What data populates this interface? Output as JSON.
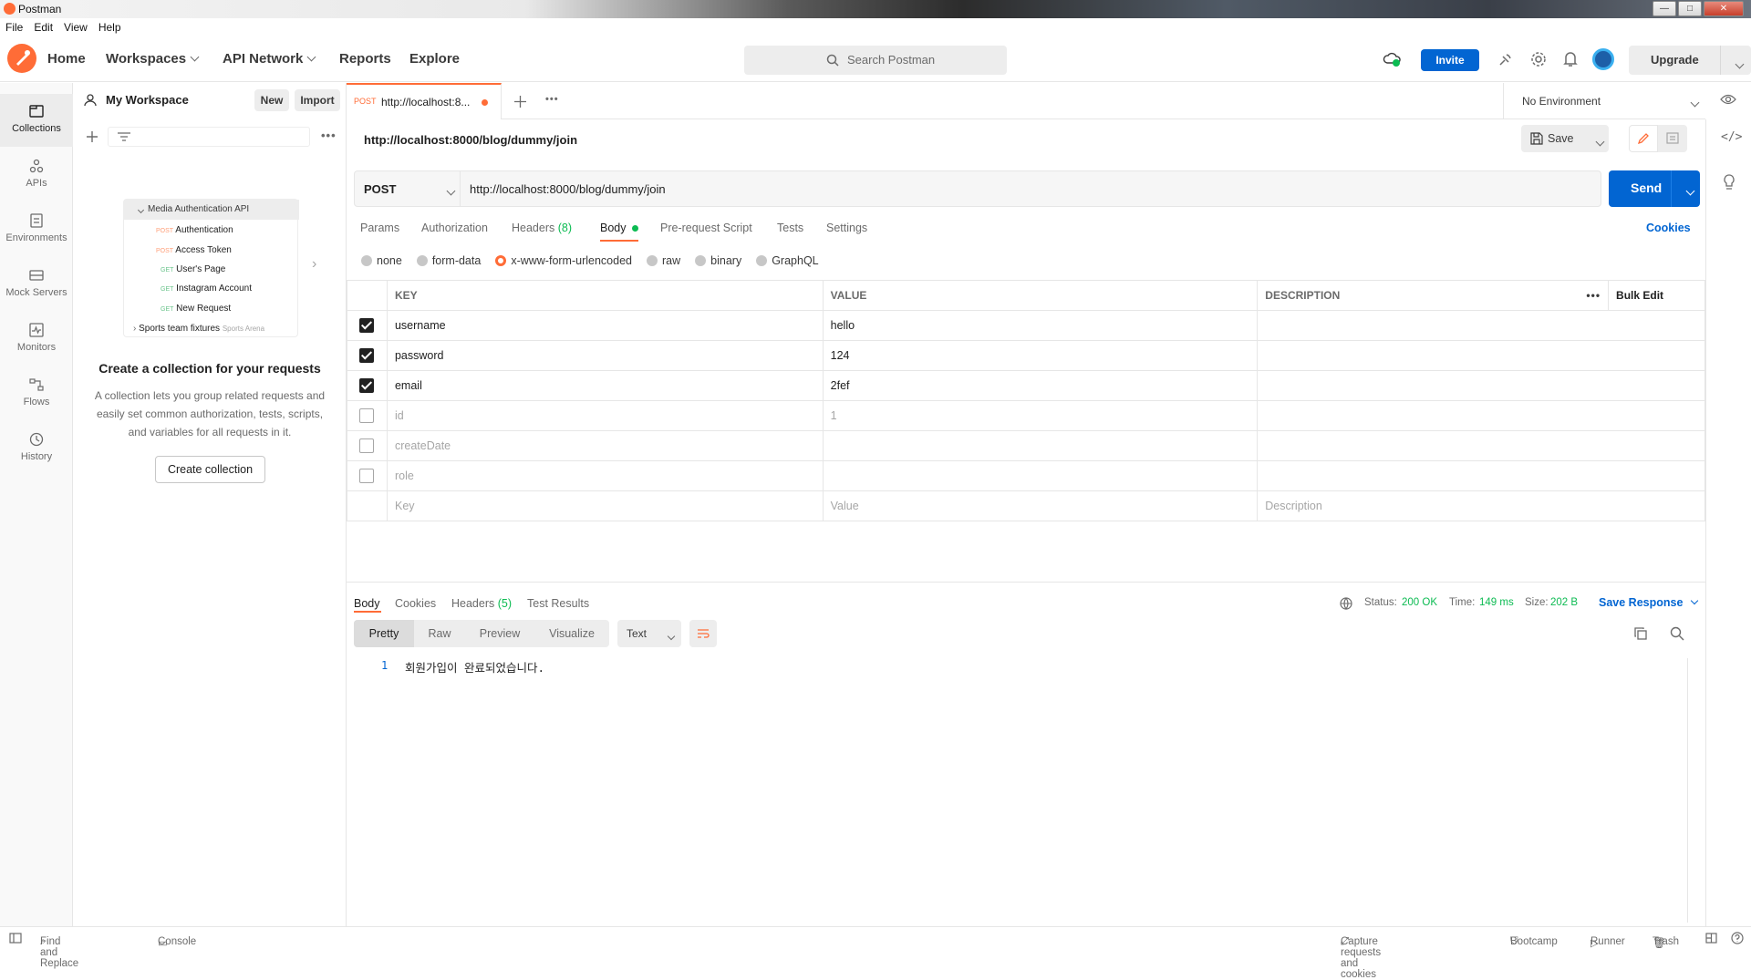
{
  "window": {
    "title": "Postman"
  },
  "menu": [
    "File",
    "Edit",
    "View",
    "Help"
  ],
  "header": {
    "nav": [
      "Home",
      "Workspaces",
      "API Network",
      "Reports",
      "Explore"
    ],
    "search_placeholder": "Search Postman",
    "invite": "Invite",
    "upgrade": "Upgrade"
  },
  "rail": [
    "Collections",
    "APIs",
    "Environments",
    "Mock Servers",
    "Monitors",
    "Flows",
    "History"
  ],
  "sidebar": {
    "workspace": "My Workspace",
    "new": "New",
    "import": "Import",
    "preview": {
      "collection": "Media Authentication API",
      "items": [
        {
          "method": "POST",
          "name": "Authentication"
        },
        {
          "method": "POST",
          "name": "Access Token"
        },
        {
          "method": "GET",
          "name": "User's Page"
        },
        {
          "method": "GET",
          "name": "Instagram Account"
        },
        {
          "method": "GET",
          "name": "New Request"
        }
      ],
      "other": "Sports team fixtures",
      "other_fork": "Sports Arena"
    },
    "empty_title": "Create a collection for your requests",
    "empty_text_1": "A collection lets you group related requests and",
    "empty_text_2": "easily set common authorization, tests, scripts,",
    "empty_text_3": "and variables for all requests in it.",
    "create_button": "Create collection"
  },
  "tab": {
    "method": "POST",
    "title": "http://localhost:8..."
  },
  "environment": "No Environment",
  "request": {
    "name": "http://localhost:8000/blog/dummy/join",
    "save": "Save",
    "method": "POST",
    "url": "http://localhost:8000/blog/dummy/join",
    "send": "Send",
    "tabs": [
      "Params",
      "Authorization",
      "Headers",
      "Body",
      "Pre-request Script",
      "Tests",
      "Settings"
    ],
    "headers_count": "(8)",
    "cookies": "Cookies",
    "body_modes": [
      "none",
      "form-data",
      "x-www-form-urlencoded",
      "raw",
      "binary",
      "GraphQL"
    ],
    "columns": [
      "KEY",
      "VALUE",
      "DESCRIPTION"
    ],
    "bulk_edit": "Bulk Edit",
    "rows": [
      {
        "key": "username",
        "value": "hello",
        "checked": true
      },
      {
        "key": "password",
        "value": "124",
        "checked": true
      },
      {
        "key": "email",
        "value": "2fef",
        "checked": true
      },
      {
        "key": "id",
        "value": "1",
        "checked": false
      },
      {
        "key": "createDate",
        "value": "",
        "checked": false
      },
      {
        "key": "role",
        "value": "",
        "checked": false
      }
    ],
    "placeholder_key": "Key",
    "placeholder_value": "Value",
    "placeholder_desc": "Description"
  },
  "response": {
    "tabs": [
      "Body",
      "Cookies",
      "Headers",
      "Test Results"
    ],
    "headers_count": "(5)",
    "status_label": "Status:",
    "status": "200 OK",
    "time_label": "Time:",
    "time": "149 ms",
    "size_label": "Size:",
    "size": "202 B",
    "save_response": "Save Response",
    "views": [
      "Pretty",
      "Raw",
      "Preview",
      "Visualize"
    ],
    "format": "Text",
    "line_no": "1",
    "line_text": "회원가입이 완료되었습니다."
  },
  "footer": {
    "find": "Find and Replace",
    "console": "Console",
    "capture": "Capture requests and cookies",
    "bootcamp": "Bootcamp",
    "runner": "Runner",
    "trash": "Trash"
  },
  "colors": {
    "accent": "#ff6c37",
    "primary": "#0265d2",
    "success": "#0cbb52"
  }
}
